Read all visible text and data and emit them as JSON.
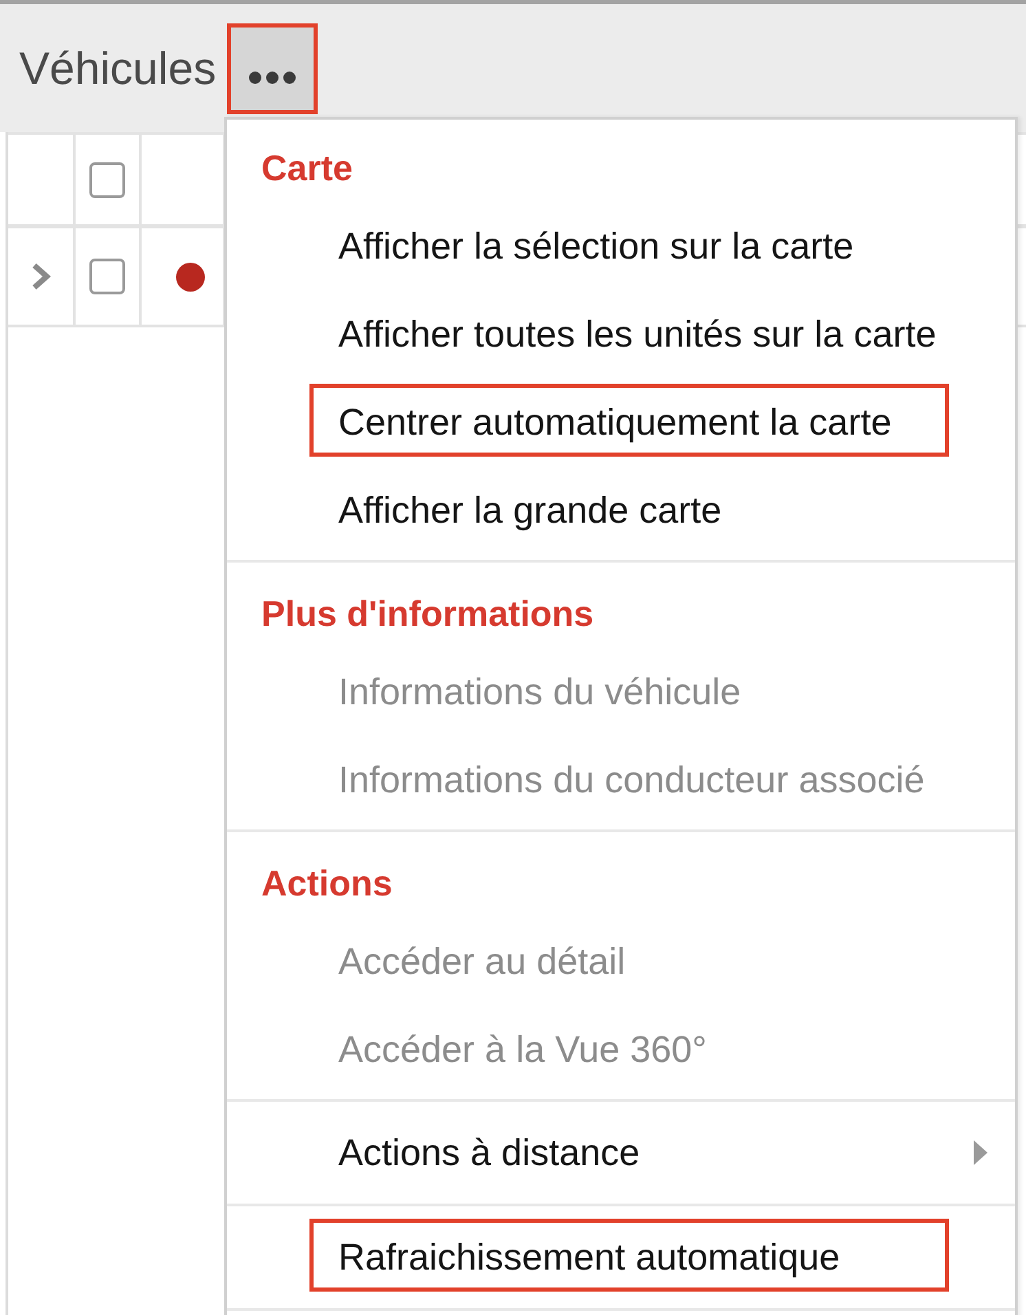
{
  "header": {
    "title": "Véhicules",
    "more_button": {
      "highlighted": true
    }
  },
  "table": {
    "header": {
      "checked": false
    },
    "rows": [
      {
        "expanded": false,
        "checked": false,
        "color": "#b8281f"
      }
    ]
  },
  "menu": {
    "sections": [
      {
        "title": "Carte",
        "items": [
          {
            "label": "Afficher la sélection sur la carte",
            "disabled": false,
            "highlighted": false,
            "submenu": false
          },
          {
            "label": "Afficher toutes les unités sur la carte",
            "disabled": false,
            "highlighted": false,
            "submenu": false
          },
          {
            "label": "Centrer automatiquement la carte",
            "disabled": false,
            "highlighted": true,
            "submenu": false
          },
          {
            "label": "Afficher la grande carte",
            "disabled": false,
            "highlighted": false,
            "submenu": false
          }
        ]
      },
      {
        "title": "Plus d'informations",
        "items": [
          {
            "label": "Informations du véhicule",
            "disabled": true,
            "highlighted": false,
            "submenu": false
          },
          {
            "label": "Informations du conducteur associé",
            "disabled": true,
            "highlighted": false,
            "submenu": false
          }
        ]
      },
      {
        "title": "Actions",
        "items": [
          {
            "label": "Accéder au détail",
            "disabled": true,
            "highlighted": false,
            "submenu": false
          },
          {
            "label": "Accéder à la Vue 360°",
            "disabled": true,
            "highlighted": false,
            "submenu": false
          }
        ]
      },
      {
        "items": [
          {
            "label": "Actions à distance",
            "disabled": false,
            "highlighted": false,
            "submenu": true
          }
        ]
      },
      {
        "items": [
          {
            "label": "Rafraichissement automatique",
            "disabled": false,
            "highlighted": true,
            "submenu": false
          }
        ]
      }
    ]
  }
}
